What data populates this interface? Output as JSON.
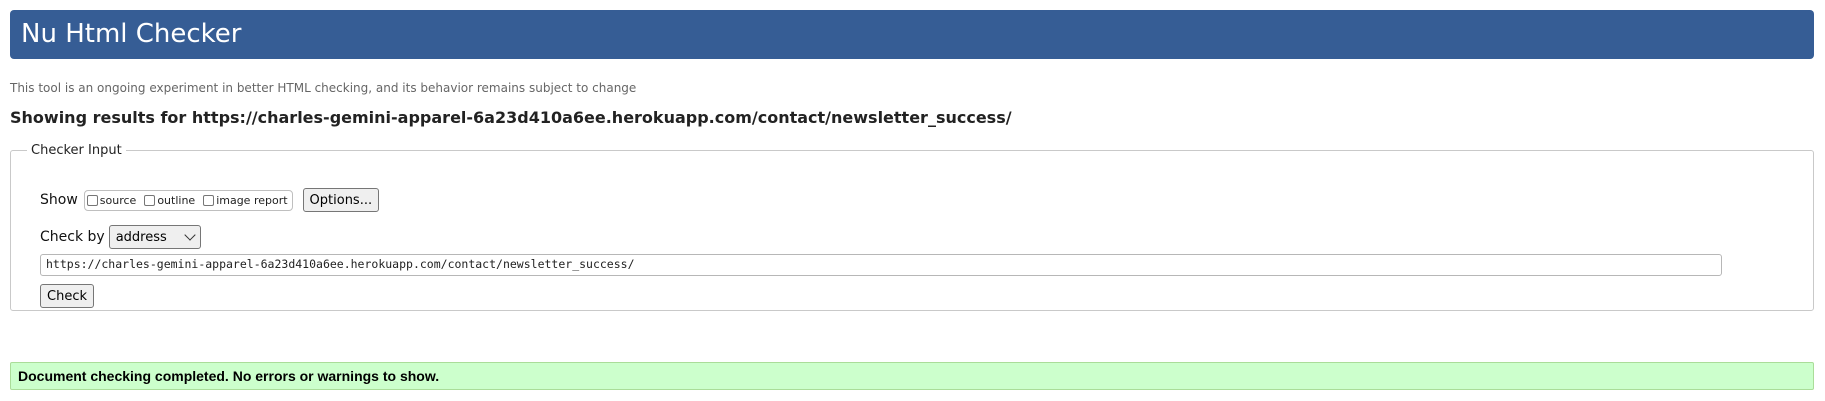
{
  "header": {
    "title": "Nu Html Checker",
    "banner_color": "#365d95"
  },
  "intro": {
    "subtitle": "This tool is an ongoing experiment in better HTML checking, and its behavior remains subject to change",
    "results_heading": "Showing results for https://charles-gemini-apparel-6a23d410a6ee.herokuapp.com/contact/newsletter_success/"
  },
  "checker_input": {
    "legend": "Checker Input",
    "show_label": "Show",
    "show_options": [
      {
        "label": "source",
        "checked": false
      },
      {
        "label": "outline",
        "checked": false
      },
      {
        "label": "image report",
        "checked": false
      }
    ],
    "options_button": "Options...",
    "check_by_label": "Check by",
    "check_by_selected": "address",
    "url_value": "https://charles-gemini-apparel-6a23d410a6ee.herokuapp.com/contact/newsletter_success/",
    "check_button": "Check"
  },
  "result": {
    "message": "Document checking completed. No errors or warnings to show.",
    "color": "#ccffcc"
  }
}
